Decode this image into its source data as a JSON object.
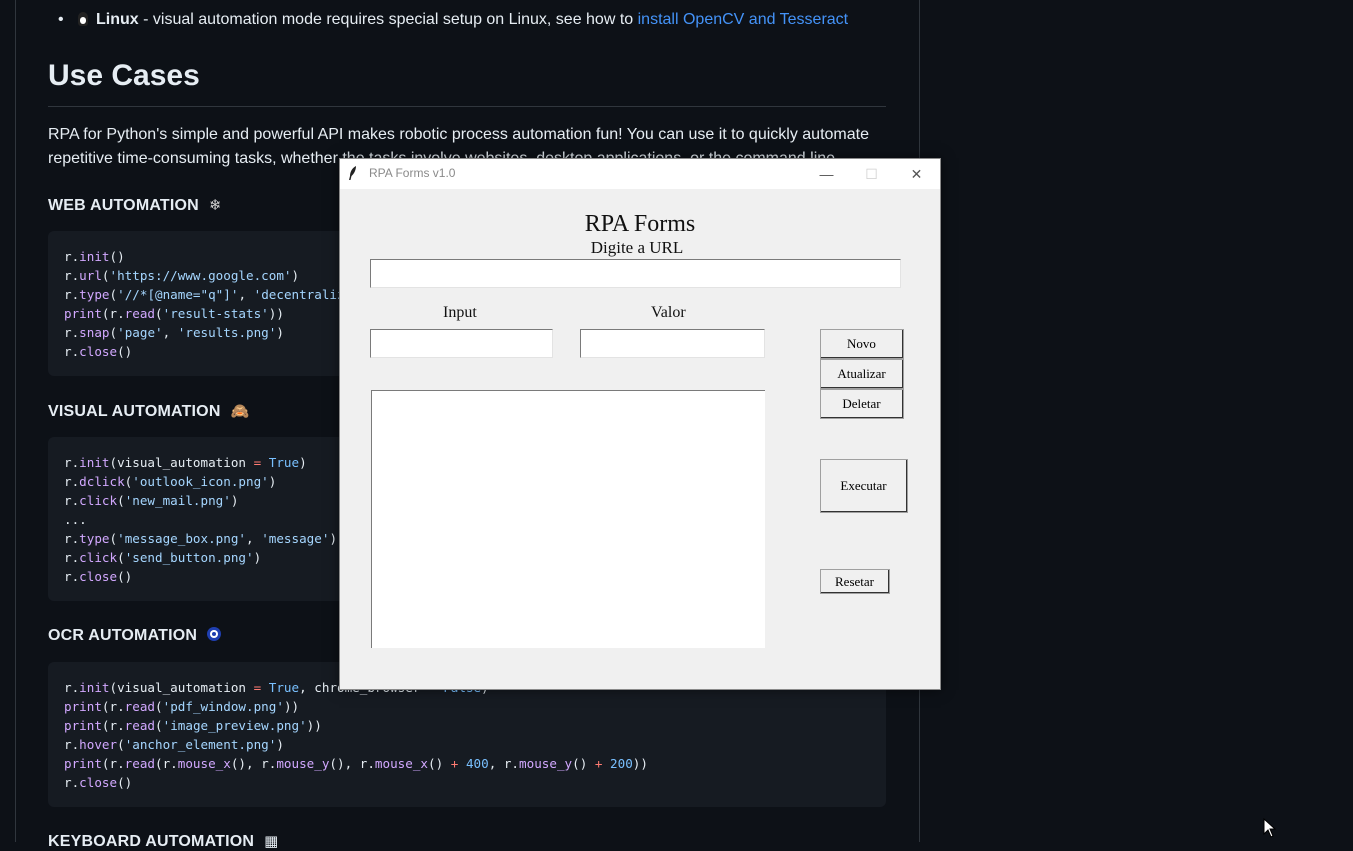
{
  "article": {
    "bullet": {
      "name": "Linux",
      "text": " - visual automation mode requires special setup on Linux, see how to ",
      "link": "install OpenCV and Tesseract"
    },
    "heading": "Use Cases",
    "paragraph": "RPA for Python's simple and powerful API makes robotic process automation fun! You can use it to quickly automate repetitive time-consuming tasks, whether the tasks involve websites, desktop applications, or the command line.",
    "sections": [
      {
        "title": "WEB AUTOMATION",
        "icon": "snowflake-icon"
      },
      {
        "title": "VISUAL AUTOMATION",
        "icon": "monkey-icon"
      },
      {
        "title": "OCR AUTOMATION",
        "icon": "eye-icon"
      },
      {
        "title": "KEYBOARD AUTOMATION",
        "icon": "keyboard-icon"
      }
    ]
  },
  "window": {
    "title": "RPA Forms v1.0",
    "heading": "RPA Forms",
    "url_label": "Digite a URL",
    "url_value": "",
    "input_label": "Input",
    "valor_label": "Valor",
    "input_value": "",
    "valor_value": "",
    "buttons": {
      "novo": "Novo",
      "atualizar": "Atualizar",
      "deletar": "Deletar",
      "executar": "Executar",
      "resetar": "Resetar"
    },
    "controls": {
      "minimize": "—",
      "maximize": "☐",
      "close": "✕"
    }
  }
}
